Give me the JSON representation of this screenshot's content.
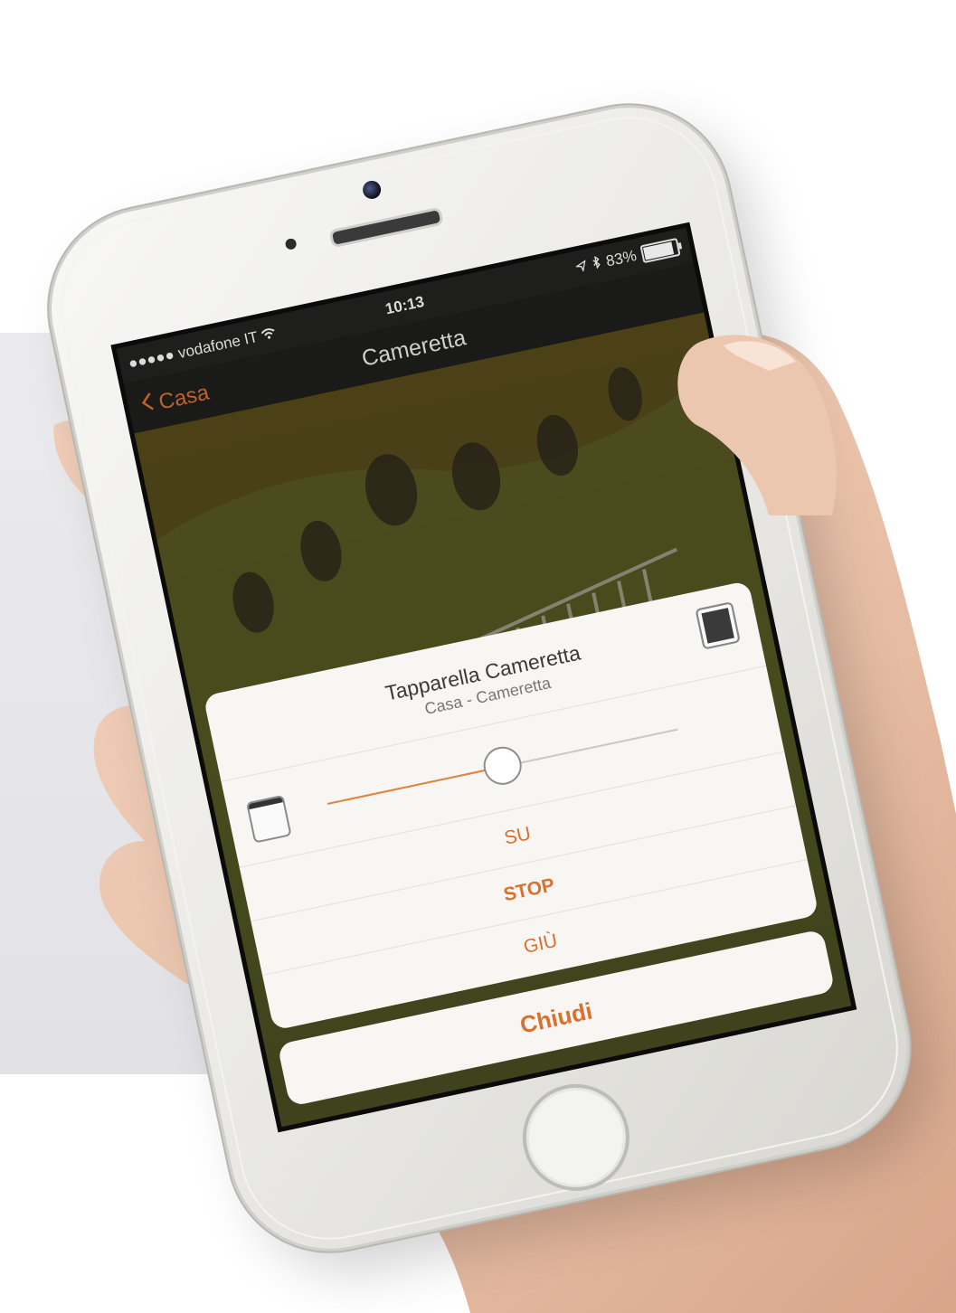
{
  "status_bar": {
    "carrier": "●●●●● vodafone IT",
    "time": "10:13",
    "battery": "83%",
    "battery_level": 0.83
  },
  "nav": {
    "back_label": "Casa",
    "title": "Cameretta"
  },
  "dialog": {
    "title": "Tapparella Cameretta",
    "subtitle": "Casa - Cameretta",
    "slider_value": 0.5,
    "actions": {
      "up": "SU",
      "stop": "STOP",
      "down": "GIÙ"
    },
    "close_label": "Chiudi"
  },
  "colors": {
    "accent": "#d9702c",
    "sheet_bg": "#f7f6f3",
    "status_bg": "#1e1e1c"
  },
  "icons": {
    "back": "chevron-left-icon",
    "wifi": "wifi-icon",
    "location": "location-arrow-icon",
    "bluetooth": "bluetooth-icon",
    "battery": "battery-icon",
    "blind_open": "blind-open-icon",
    "blind_closed": "blind-closed-icon"
  }
}
